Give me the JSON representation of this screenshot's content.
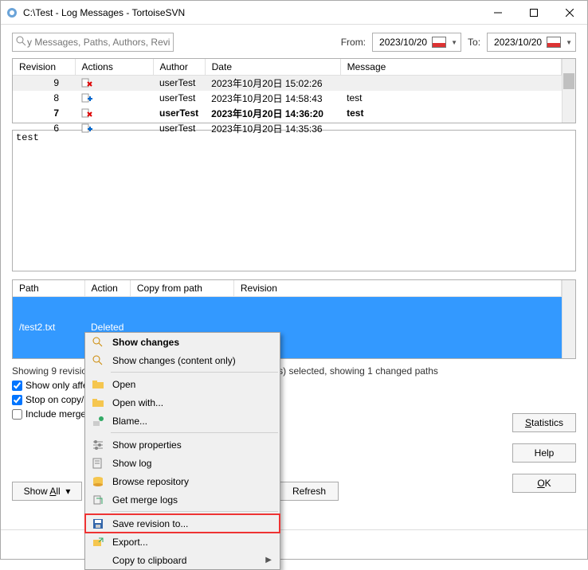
{
  "window": {
    "title": "C:\\Test - Log Messages - TortoiseSVN"
  },
  "search": {
    "placeholder": "y Messages, Paths, Authors, Revisions, Bug-IDs, Date, Dat"
  },
  "filter": {
    "from_label": "From:",
    "from": "2023/10/20",
    "to_label": "To:",
    "to": "2023/10/20"
  },
  "columns": {
    "rev": "Revision",
    "act": "Actions",
    "auth": "Author",
    "date": "Date",
    "msg": "Message"
  },
  "revisions": [
    {
      "rev": "9",
      "author": "userTest",
      "date": "2023年10月20日 15:02:26",
      "msg": "",
      "icon": "del",
      "selected": true,
      "bold": false
    },
    {
      "rev": "8",
      "author": "userTest",
      "date": "2023年10月20日 14:58:43",
      "msg": "test",
      "icon": "add",
      "selected": false,
      "bold": false
    },
    {
      "rev": "7",
      "author": "userTest",
      "date": "2023年10月20日 14:36:20",
      "msg": "test",
      "icon": "del",
      "selected": false,
      "bold": true
    },
    {
      "rev": "6",
      "author": "userTest",
      "date": "2023年10月20日 14:35:36",
      "msg": "",
      "icon": "add",
      "selected": false,
      "bold": false
    }
  ],
  "message_text": "test",
  "file_columns": {
    "path": "Path",
    "action": "Action",
    "copy": "Copy from path",
    "rev": "Revision"
  },
  "files": [
    {
      "path": "/test2.txt",
      "action": "Deleted"
    }
  ],
  "status_line": "Showing 9 revision(s), from revision 1 to revision 9 - 1 revision(s) selected, showing 1 changed paths",
  "checks": {
    "affected": "Show only affected paths",
    "stop": "Stop on copy/rename",
    "merged": "Include merged revisions"
  },
  "buttons": {
    "statistics": "Statistics",
    "help": "Help",
    "ok": "OK",
    "showall": "Show All",
    "refresh": "Refresh"
  },
  "ctx": {
    "show_changes": "Show changes",
    "show_changes_content": "Show changes (content only)",
    "open": "Open",
    "open_with": "Open with...",
    "blame": "Blame...",
    "show_properties": "Show properties",
    "show_log": "Show log",
    "browse": "Browse repository",
    "merge_logs": "Get merge logs",
    "save_rev": "Save revision to...",
    "export": "Export...",
    "copy_clip": "Copy to clipboard"
  }
}
